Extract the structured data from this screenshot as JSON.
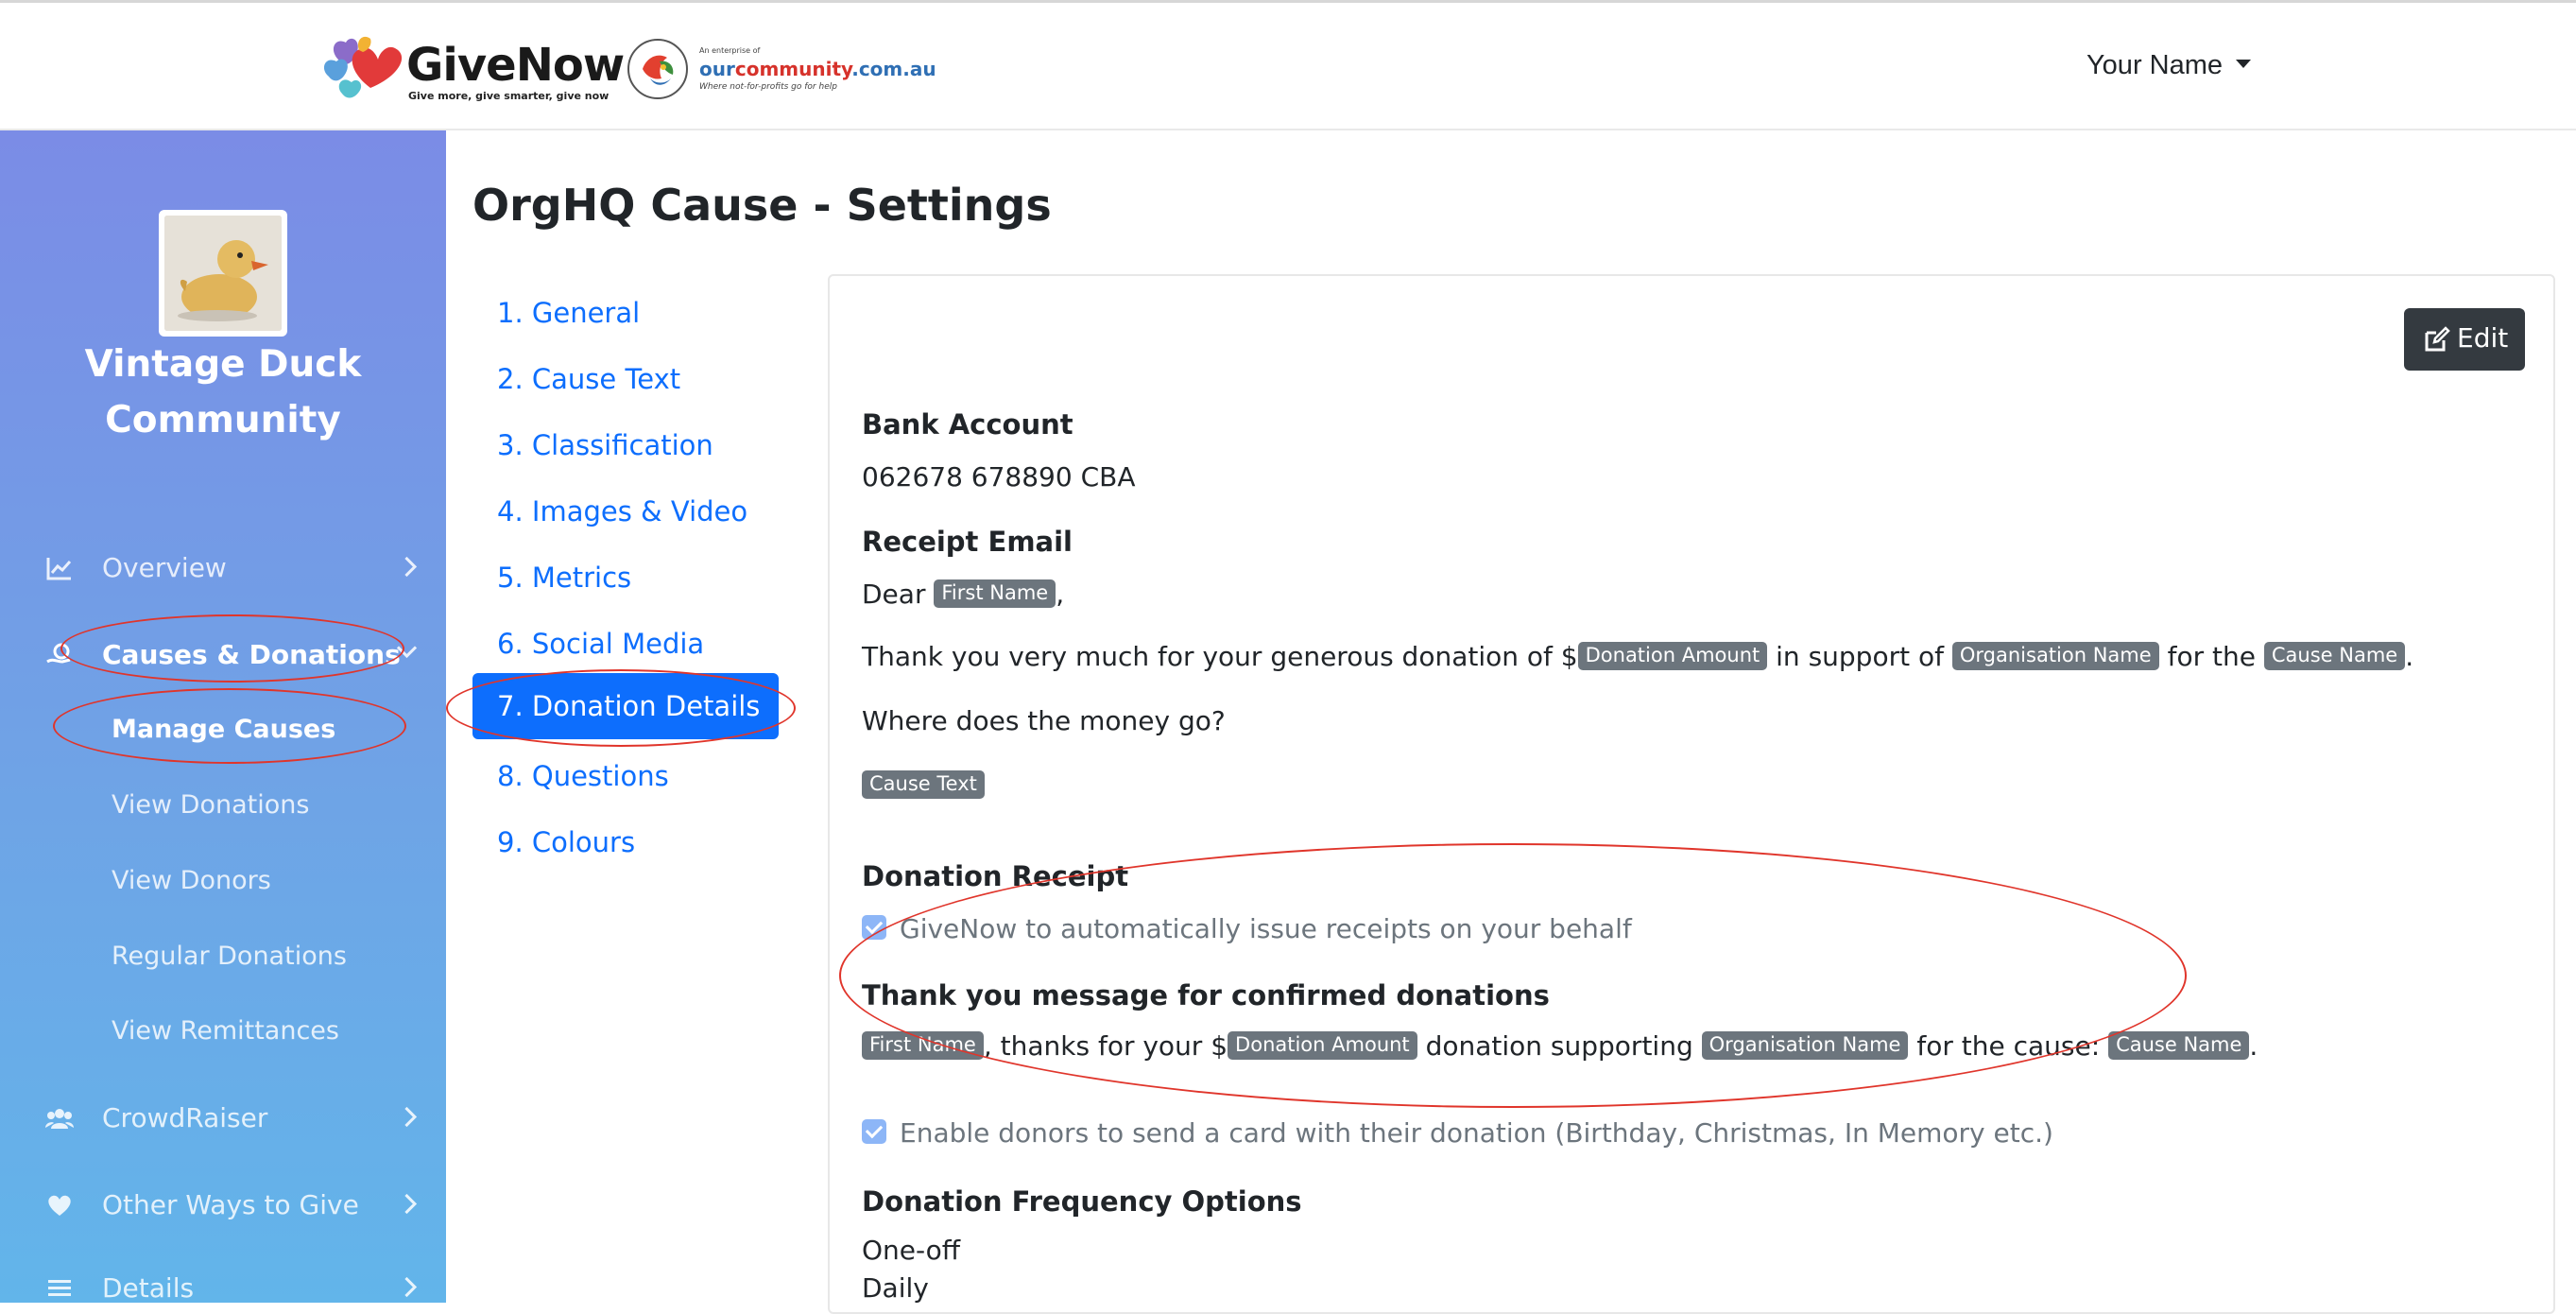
{
  "header": {
    "logo_word": "GiveNow",
    "logo_tagline": "Give more, give smarter, give now",
    "partner_small": "An enterprise of",
    "partner_name_blue": "our",
    "partner_name_red": "community",
    "partner_name_domain": ".com.au",
    "partner_tagline": "Where not-for-profits go for help",
    "user_menu_label": "Your Name"
  },
  "sidebar": {
    "org_name": "Vintage Duck Community",
    "items": [
      {
        "label": "Overview",
        "icon": "chart-line-icon"
      },
      {
        "label": "Causes & Donations",
        "icon": "hand-coin-icon"
      },
      {
        "label": "CrowdRaiser",
        "icon": "users-icon"
      },
      {
        "label": "Other Ways to Give",
        "icon": "heart-icon"
      },
      {
        "label": "Details",
        "icon": "list-icon"
      }
    ],
    "sub_items": [
      {
        "label": "Manage Causes"
      },
      {
        "label": "View Donations"
      },
      {
        "label": "View Donors"
      },
      {
        "label": "Regular Donations"
      },
      {
        "label": "View Remittances"
      }
    ]
  },
  "main": {
    "title": "OrgHQ Cause - Settings",
    "steps": [
      {
        "label": "1. General"
      },
      {
        "label": "2. Cause Text"
      },
      {
        "label": "3. Classification"
      },
      {
        "label": "4. Images & Video"
      },
      {
        "label": "5. Metrics"
      },
      {
        "label": "6. Social Media"
      },
      {
        "label": "7. Donation Details"
      },
      {
        "label": "8. Questions"
      },
      {
        "label": "9. Colours"
      }
    ],
    "edit_label": "Edit"
  },
  "details": {
    "bank_heading": "Bank Account",
    "bank_value": "062678 678890 CBA",
    "receipt_heading": "Receipt Email",
    "dear": "Dear",
    "comma": ",",
    "thanks_1": "Thank you very much for your generous donation of $",
    "thanks_2": "in support of",
    "thanks_3": "for the",
    "period": ".",
    "where_money": "Where does the money go?",
    "badges": {
      "first_name": "First Name",
      "donation_amount": "Donation Amount",
      "organisation_name": "Organisation Name",
      "cause_name": "Cause Name",
      "cause_text": "Cause Text"
    },
    "receipt_section_heading": "Donation Receipt",
    "auto_receipt_label": "GiveNow to automatically issue receipts on your behalf",
    "confirmed_heading": "Thank you message for confirmed donations",
    "confirmed_1": ", thanks for your $",
    "confirmed_2": "donation supporting",
    "confirmed_3": "for the cause:",
    "card_label": "Enable donors to send a card with their donation (Birthday, Christmas, In Memory etc.)",
    "frequency_heading": "Donation Frequency Options",
    "frequencies": [
      "One-off",
      "Daily"
    ]
  },
  "colors": {
    "primary": "#0d6efd",
    "sidebar_top": "#7b8ce6",
    "sidebar_bottom": "#62b5ea",
    "annotation": "#e0352b",
    "badge": "#6c757d",
    "edit_button": "#343a40"
  }
}
